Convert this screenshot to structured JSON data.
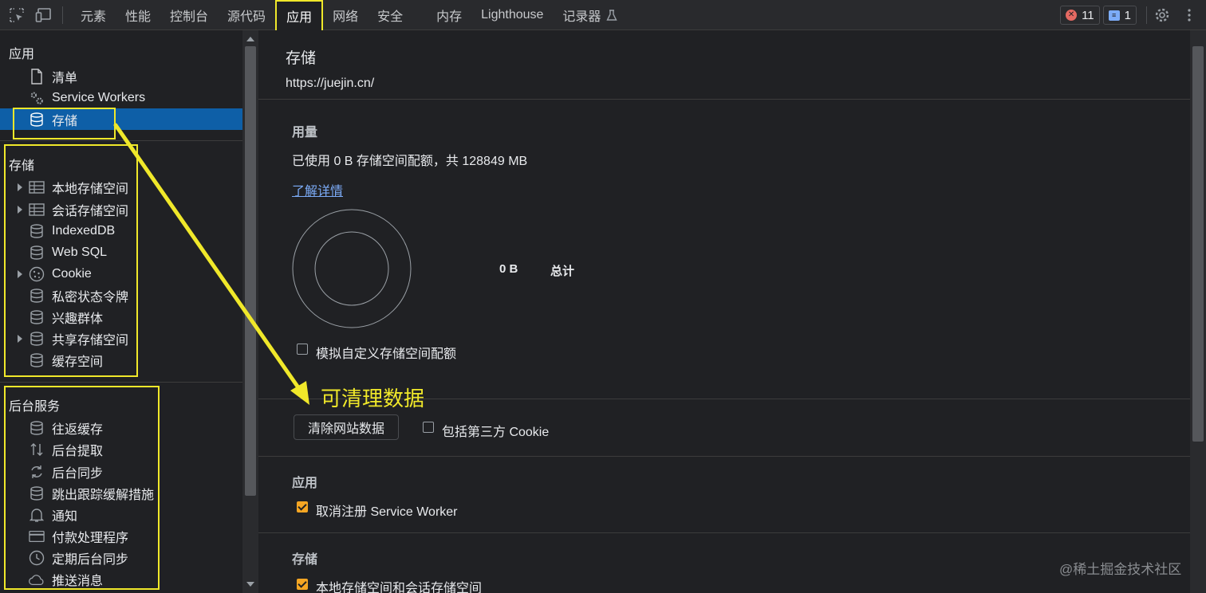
{
  "toolbar": {
    "tabs": [
      "元素",
      "性能",
      "控制台",
      "源代码",
      "应用",
      "网络",
      "安全",
      "内存",
      "Lighthouse",
      "记录器"
    ],
    "active_tab": "应用",
    "errors_count": "11",
    "messages_count": "1"
  },
  "sidebar": {
    "app_section": "应用",
    "app_items": [
      "清单",
      "Service Workers",
      "存储"
    ],
    "storage_section": "存储",
    "storage_items": [
      "本地存储空间",
      "会话存储空间",
      "IndexedDB",
      "Web SQL",
      "Cookie",
      "私密状态令牌",
      "兴趣群体",
      "共享存储空间",
      "缓存空间"
    ],
    "bg_section": "后台服务",
    "bg_items": [
      "往返缓存",
      "后台提取",
      "后台同步",
      "跳出跟踪缓解措施",
      "通知",
      "付款处理程序",
      "定期后台同步",
      "推送消息"
    ]
  },
  "main": {
    "title": "存储",
    "origin": "https://juejin.cn/",
    "usage_heading": "用量",
    "usage_text": "已使用 0 B 存储空间配额，共 128849 MB",
    "learn_more": "了解详情",
    "chart_value": "0 B",
    "chart_total_label": "总计",
    "simulate_quota_label": "模拟自定义存储空间配额",
    "annotation": "可清理数据",
    "clear_button": "清除网站数据",
    "include_third_party_label": "包括第三方 Cookie",
    "app_heading": "应用",
    "unregister_sw_label": "取消注册 Service Worker",
    "storage_heading": "存储",
    "local_session_label": "本地存储空间和会话存储空间"
  },
  "watermark": "@稀土掘金技术社区",
  "colors": {
    "accent_highlight": "#f0e82a",
    "selected_bg": "#0e5fa7",
    "checkbox_checked": "#f5a623",
    "link": "#7cacf8"
  }
}
